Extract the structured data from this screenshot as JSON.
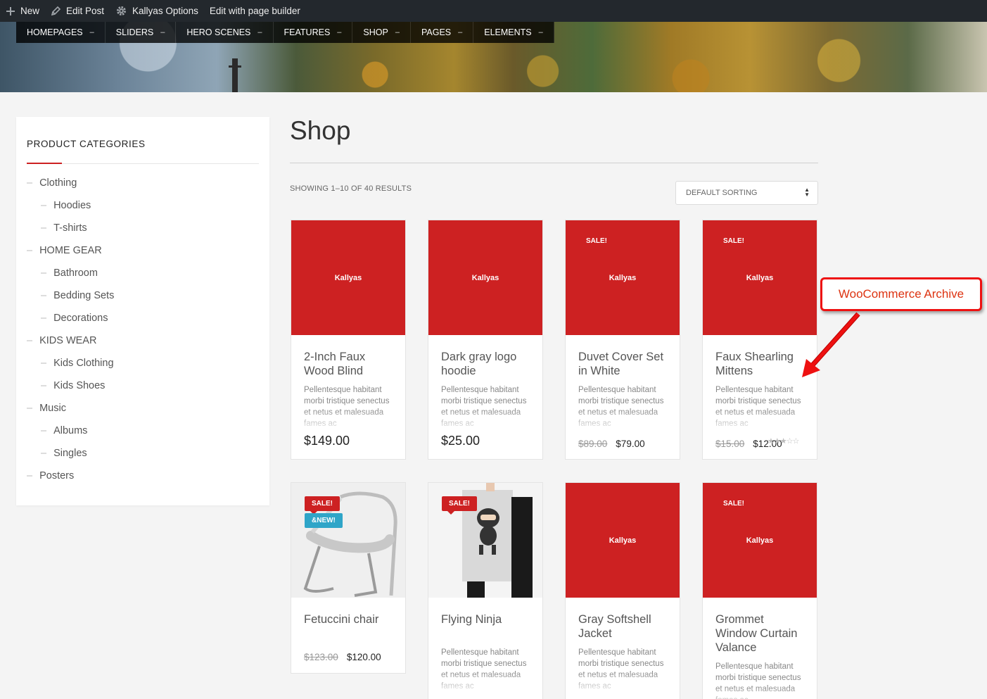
{
  "adminbar": {
    "new": "New",
    "edit_post": "Edit Post",
    "options": "Kallyas Options",
    "page_builder": "Edit with page builder"
  },
  "nav": [
    {
      "label": "HOMEPAGES"
    },
    {
      "label": "SLIDERS"
    },
    {
      "label": "HERO SCENES"
    },
    {
      "label": "FEATURES"
    },
    {
      "label": "SHOP"
    },
    {
      "label": "PAGES"
    },
    {
      "label": "ELEMENTS"
    }
  ],
  "sidebar": {
    "title": "PRODUCT CATEGORIES",
    "categories": [
      {
        "label": "Clothing",
        "level": 0
      },
      {
        "label": "Hoodies",
        "level": 1
      },
      {
        "label": "T-shirts",
        "level": 1
      },
      {
        "label": "HOME GEAR",
        "level": 0
      },
      {
        "label": "Bathroom",
        "level": 1
      },
      {
        "label": "Bedding Sets",
        "level": 1
      },
      {
        "label": "Decorations",
        "level": 1
      },
      {
        "label": "KIDS WEAR",
        "level": 0
      },
      {
        "label": "Kids Clothing",
        "level": 1
      },
      {
        "label": "Kids Shoes",
        "level": 1
      },
      {
        "label": "Music",
        "level": 0
      },
      {
        "label": "Albums",
        "level": 1
      },
      {
        "label": "Singles",
        "level": 1
      },
      {
        "label": "Posters",
        "level": 0
      }
    ]
  },
  "shop": {
    "title": "Shop",
    "result_count": "SHOWING 1–10 OF 40 RESULTS",
    "sorting": "DEFAULT SORTING"
  },
  "products": [
    {
      "name": "2-Inch Faux Wood Blind",
      "image_text": "Kallyas",
      "desc": "Pellentesque habitant morbi tristique senectus et netus et malesuada fames ac",
      "price": "$149.00"
    },
    {
      "name": "Dark gray logo hoodie",
      "image_text": "Kallyas",
      "desc": "Pellentesque habitant morbi tristique senectus et netus et malesuada fames ac",
      "price": "$25.00"
    },
    {
      "name": "Duvet Cover Set in White",
      "image_text": "Kallyas",
      "badge": "SALE!",
      "desc": "Pellentesque habitant morbi tristique senectus et netus et malesuada fames ac",
      "old_price": "$89.00",
      "new_price": "$79.00"
    },
    {
      "name": "Faux Shearling Mittens",
      "image_text": "Kallyas",
      "badge": "SALE!",
      "desc": "Pellentesque habitant morbi tristique senectus et netus et malesuada fames ac",
      "old_price": "$15.00",
      "new_price": "$12.00"
    },
    {
      "name": "Fetuccini chair",
      "badge": "SALE!",
      "badge2": "&NEW!",
      "old_price": "$123.00",
      "new_price": "$120.00"
    },
    {
      "name": "Flying Ninja",
      "badge": "SALE!",
      "desc": "Pellentesque habitant morbi tristique senectus et netus et malesuada fames ac"
    },
    {
      "name": "Gray Softshell Jacket",
      "image_text": "Kallyas",
      "desc": "Pellentesque habitant morbi tristique senectus et netus et malesuada fames ac"
    },
    {
      "name": "Grommet Window Curtain Valance",
      "image_text": "Kallyas",
      "badge": "SALE!",
      "desc": "Pellentesque habitant morbi tristique senectus et netus et malesuada fames ac"
    }
  ],
  "annotation": "WooCommerce Archive",
  "colors": {
    "accent": "#cd2122",
    "new_badge": "#2fa5c8",
    "annotation": "#e11111"
  }
}
